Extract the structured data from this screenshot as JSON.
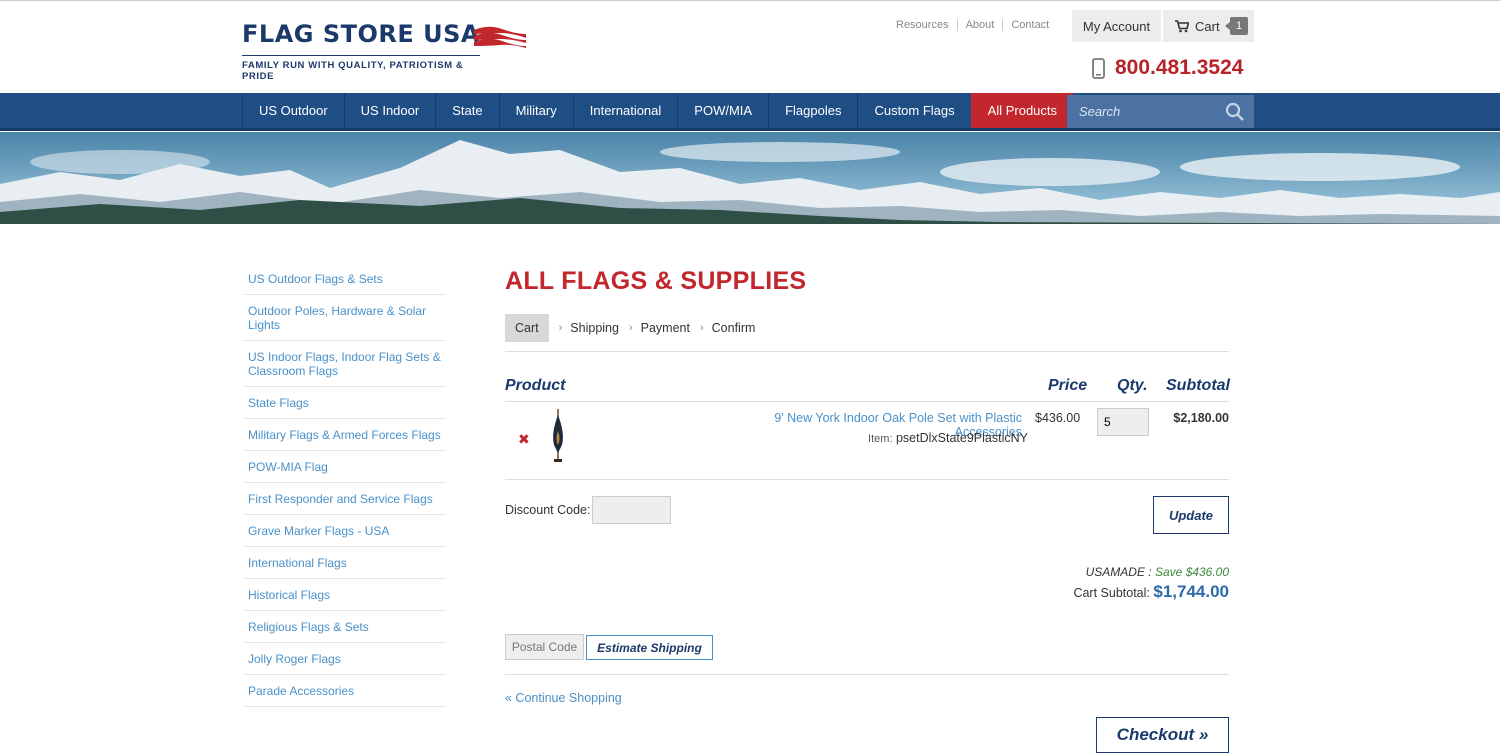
{
  "brand": {
    "name": "FLAG STORE USA",
    "tagline": "FAMILY RUN WITH QUALITY, PATRIOTISM & PRIDE",
    "primary_color": "#1b3a6b",
    "accent_color": "#c1272d"
  },
  "top_links": [
    "Resources",
    "About",
    "Contact"
  ],
  "account": {
    "label": "My Account"
  },
  "cart": {
    "label": "Cart",
    "count": "1",
    "icon": "cart-icon"
  },
  "phone": {
    "number": "800.481.3524",
    "icon": "phone-icon"
  },
  "nav": {
    "items": [
      "US Outdoor",
      "US Indoor",
      "State",
      "Military",
      "International",
      "POW/MIA",
      "Flagpoles",
      "Custom Flags",
      "All Products"
    ],
    "active": "All Products",
    "search_placeholder": "Search"
  },
  "sidebar": {
    "items": [
      "US Outdoor Flags & Sets",
      "Outdoor Poles, Hardware & Solar Lights",
      "US Indoor Flags, Indoor Flag Sets & Classroom Flags",
      "State Flags",
      "Military Flags & Armed Forces Flags",
      "POW-MIA Flag",
      "First Responder and Service Flags",
      "Grave Marker Flags - USA",
      "International Flags",
      "Historical Flags",
      "Religious Flags & Sets",
      "Jolly Roger Flags",
      "Parade Accessories"
    ]
  },
  "main": {
    "title": "ALL FLAGS & SUPPLIES",
    "steps": [
      "Cart",
      "Shipping",
      "Payment",
      "Confirm"
    ],
    "current_step": "Cart",
    "table_headers": {
      "product": "Product",
      "price": "Price",
      "qty": "Qty.",
      "subtotal": "Subtotal"
    },
    "item": {
      "name": "9' New York Indoor Oak Pole Set with Plastic Accessories",
      "sku_label": "Item:",
      "sku": "psetDlxState9PlasticNY",
      "price": "$436.00",
      "qty": "5",
      "subtotal": "$2,180.00"
    },
    "discount_label": "Discount Code:",
    "update_label": "Update",
    "promo_code": "USAMADE",
    "promo_separator": " : ",
    "promo_save": "Save $436.00",
    "cart_subtotal_label": "Cart Subtotal:",
    "cart_subtotal_value": "$1,744.00",
    "postal_placeholder": "Postal Code",
    "estimate_label": "Estimate Shipping",
    "continue_label": "« Continue Shopping",
    "checkout_label": "Checkout »"
  }
}
